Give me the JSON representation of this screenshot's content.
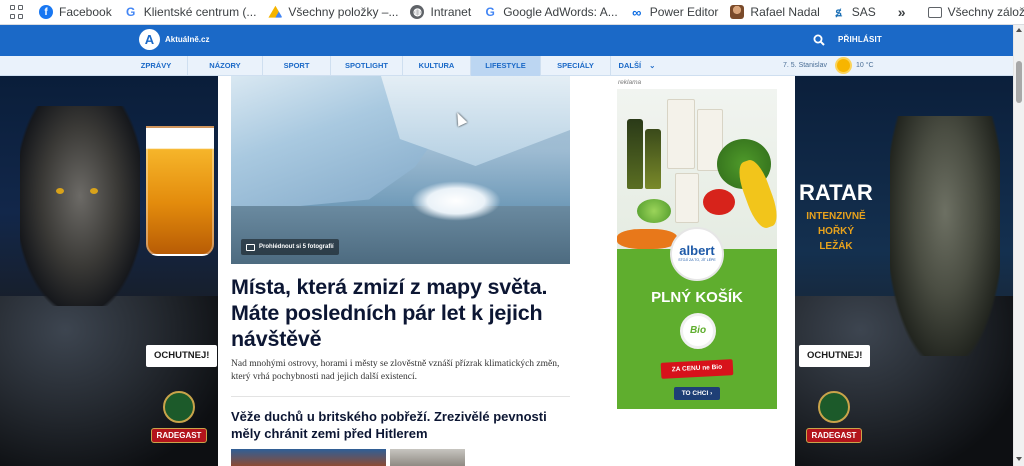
{
  "bookmarks": {
    "items": [
      {
        "label": "Facebook",
        "icon": "facebook-icon",
        "color": "#1877f2"
      },
      {
        "label": "Klientské centrum (...",
        "icon": "google-icon",
        "color": "#4285f4"
      },
      {
        "label": "Všechny položky –...",
        "icon": "google-drive-icon",
        "color": "#0f9d58"
      },
      {
        "label": "Intranet",
        "icon": "globe-icon",
        "color": "#5f6368"
      },
      {
        "label": "Google AdWords: A...",
        "icon": "google-icon",
        "color": "#4285f4"
      },
      {
        "label": "Power Editor",
        "icon": "meta-icon",
        "color": "#0668e1"
      },
      {
        "label": "Rafael Nadal",
        "icon": "profile-photo-icon",
        "color": "#a0522d"
      },
      {
        "label": "SAS",
        "icon": "sas-icon",
        "color": "#1b6fb5"
      }
    ],
    "overflow": "»",
    "folder_label": "Všechny záložky"
  },
  "site": {
    "logo_mark": "A",
    "logo_text": "Aktuálně.cz",
    "login": "PŘIHLÁSIT",
    "brand_color": "#1b69c7"
  },
  "nav": {
    "items": [
      {
        "label": "ZPRÁVY"
      },
      {
        "label": "NÁZORY"
      },
      {
        "label": "SPORT"
      },
      {
        "label": "SPOTLIGHT"
      },
      {
        "label": "KULTURA"
      },
      {
        "label": "LIFESTYLE",
        "active": true
      },
      {
        "label": "SPECIÁLY"
      },
      {
        "label": "DALŠÍ"
      }
    ],
    "more_arrow": "⌄",
    "date": "7. 5. Stanislav",
    "temperature": "10 °C"
  },
  "article": {
    "gallery_badge": "Prohlédnout si 5 fotografií",
    "title": "Místa, která zmizí z mapy světa. Máte posledních pár let k jejich návštěvě",
    "perex": "Nad mnohými ostrovy, horami i městy se zlověstně vznáší přízrak klimatických změn, který vrhá pochybnosti nad jejich další existencí."
  },
  "next_article": {
    "title": "Věže duchů u britského pobřeží. Zrezivělé pevnosti měly chránit zemi před Hitlerem"
  },
  "ads": {
    "label": "reklama",
    "left": {
      "ochutnej": "OCHUTNEJ!",
      "brand": "RADEGAST"
    },
    "right": {
      "headline": "RATAR",
      "sub": "INTENZIVNĚ HOŘKÝ LEŽÁK",
      "ochutnej": "OCHUTNEJ!",
      "brand": "RADEGAST"
    },
    "albert": {
      "logo": "albert",
      "logo_sub": "STOJÍ ZA TO, JÍT LÉPE",
      "headline": "PLNÝ KOŠÍK",
      "bio": "Bio",
      "price_tag": "ZA CENU ne Bio",
      "cta": "TO CHCI ›",
      "bg": "#5fae2e"
    }
  }
}
